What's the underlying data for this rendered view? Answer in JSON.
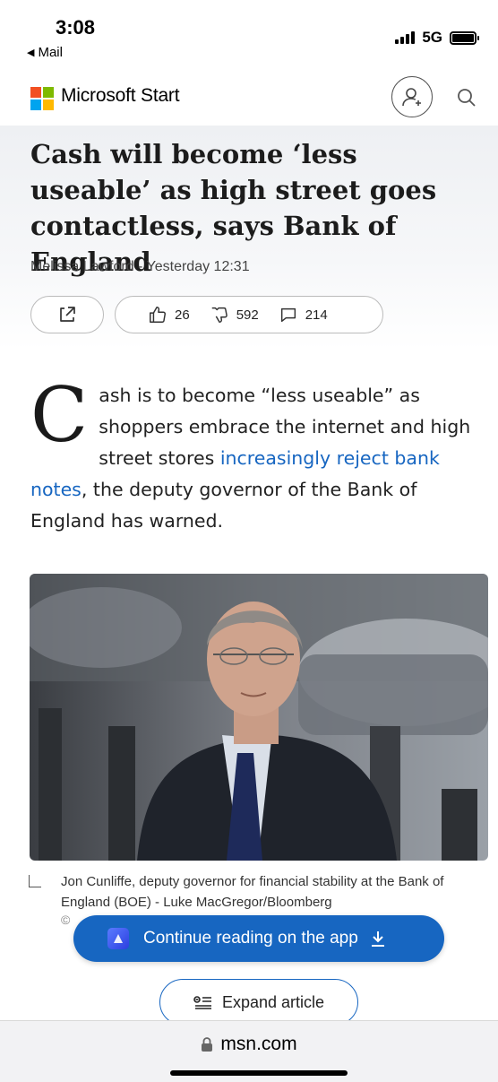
{
  "status_bar": {
    "time": "3:08",
    "back_label": "Mail",
    "network": "5G"
  },
  "header": {
    "brand": "Microsoft Start",
    "logo_colors": [
      "#f25022",
      "#7fba00",
      "#00a4ef",
      "#ffb900"
    ]
  },
  "article": {
    "headline": "Cash will become ‘less useable’ as high street goes contactless, says Bank of England",
    "byline": "Melissa Lawford - Yesterday 12:31",
    "likes": "26",
    "dislikes": "592",
    "comments": "214",
    "dropcap": "C",
    "body_lead": "ash is to become “less useable” as shoppers embrace the internet and high street stores ",
    "body_link": "increasingly reject bank notes",
    "body_tail": ", the deputy governor of the Bank of England has warned.",
    "caption": "Jon Cunliffe, deputy governor for financial stability at the Bank of England (BOE) - Luke MacGregor/Bloomberg",
    "copyright": "©",
    "image_alt_icon": "photo-man-in-suit"
  },
  "actions": {
    "continue_label": "Continue reading on the app",
    "expand_label": "Expand article"
  },
  "browser": {
    "url": "msn.com"
  },
  "colors": {
    "accent": "#1766c1"
  }
}
